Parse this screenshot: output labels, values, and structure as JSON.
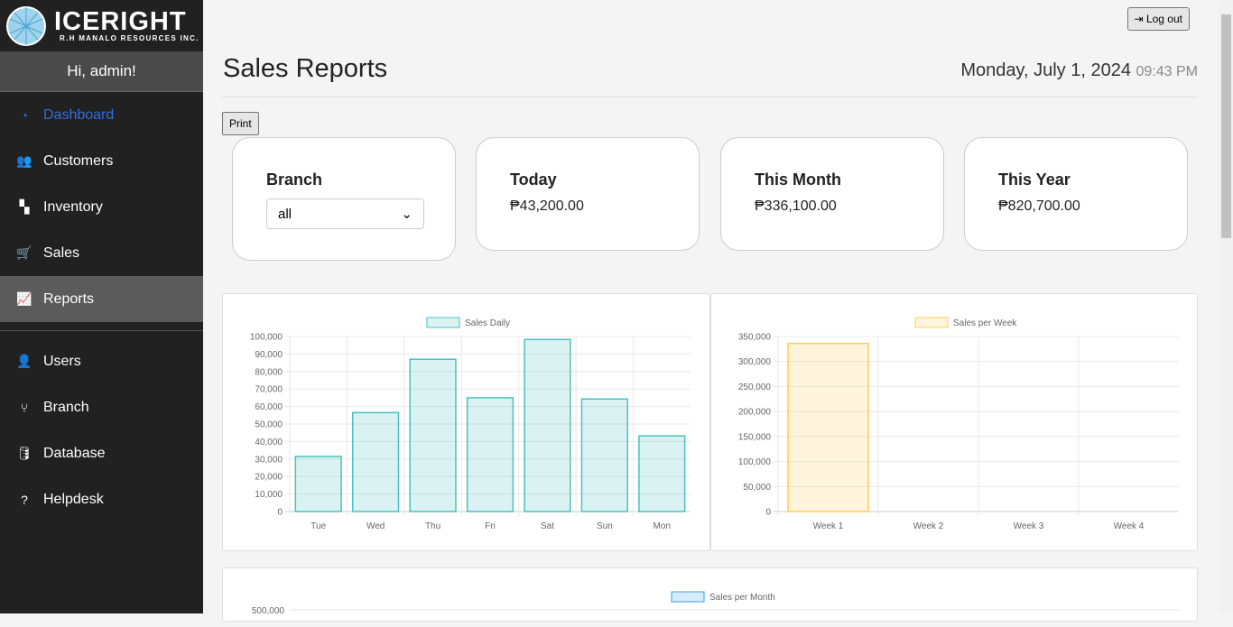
{
  "brand": {
    "title": "ICERIGHT",
    "subtitle": "R.H MANALO RESOURCES INC."
  },
  "greeting": "Hi, admin!",
  "nav": [
    {
      "label": "Dashboard",
      "icon": "gauge-icon"
    },
    {
      "label": "Customers",
      "icon": "users-icon"
    },
    {
      "label": "Inventory",
      "icon": "boxes-icon"
    },
    {
      "label": "Sales",
      "icon": "cart-icon"
    },
    {
      "label": "Reports",
      "icon": "chart-line-icon"
    },
    {
      "label": "Users",
      "icon": "user-icon"
    },
    {
      "label": "Branch",
      "icon": "branch-icon"
    },
    {
      "label": "Database",
      "icon": "database-icon"
    },
    {
      "label": "Helpdesk",
      "icon": "question-icon"
    }
  ],
  "header": {
    "logout": "Log out",
    "title": "Sales Reports",
    "date": "Monday, July 1, 2024",
    "time": "09:43 PM",
    "print": "Print"
  },
  "cards": {
    "branch_label": "Branch",
    "branch_value": "all",
    "today_label": "Today",
    "today_value": "₱43,200.00",
    "month_label": "This Month",
    "month_value": "₱336,100.00",
    "year_label": "This Year",
    "year_value": "₱820,700.00"
  },
  "colors": {
    "daily": "#4bc0c0",
    "weekly": "#ffcd56",
    "monthly": "#36a2eb",
    "active_nav": "#2f6fdc"
  },
  "chart_data": [
    {
      "type": "bar",
      "legend": "Sales Daily",
      "categories": [
        "Tue",
        "Wed",
        "Thu",
        "Fri",
        "Sat",
        "Sun",
        "Mon"
      ],
      "values": [
        31500,
        56500,
        87000,
        65000,
        98300,
        64300,
        43200
      ],
      "ylim": [
        0,
        100000
      ],
      "yticks": [
        "0",
        "10,000",
        "20,000",
        "30,000",
        "40,000",
        "50,000",
        "60,000",
        "70,000",
        "80,000",
        "90,000",
        "100,000"
      ],
      "grid": true,
      "legend_position": "top"
    },
    {
      "type": "bar",
      "legend": "Sales per Week",
      "categories": [
        "Week 1",
        "Week 2",
        "Week 3",
        "Week 4"
      ],
      "values": [
        336100,
        0,
        0,
        0
      ],
      "ylim": [
        0,
        350000
      ],
      "yticks": [
        "0",
        "50,000",
        "100,000",
        "150,000",
        "200,000",
        "250,000",
        "300,000",
        "350,000"
      ],
      "grid": true,
      "legend_position": "top"
    },
    {
      "type": "bar",
      "legend": "Sales per Month",
      "yticks_visible": [
        "500,000"
      ],
      "legend_position": "top"
    }
  ]
}
